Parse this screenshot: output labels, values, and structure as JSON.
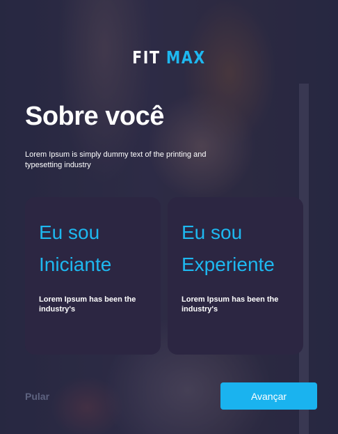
{
  "brand": {
    "part1": "FIT",
    "part2": "MAX"
  },
  "header": {
    "title": "Sobre você",
    "subtitle": "Lorem Ipsum is simply dummy text of the printing and typesetting industry"
  },
  "options": [
    {
      "line1": "Eu sou",
      "line2": "Iniciante",
      "description": "Lorem Ipsum has been the industry's"
    },
    {
      "line1": "Eu sou",
      "line2": "Experiente",
      "description": "Lorem Ipsum has been the industry's"
    }
  ],
  "footer": {
    "skip_label": "Pular",
    "next_label": "Avançar"
  },
  "colors": {
    "accent": "#1eb8f0",
    "card": "#2c2642",
    "muted": "#5e6380",
    "text": "#ffffff"
  }
}
